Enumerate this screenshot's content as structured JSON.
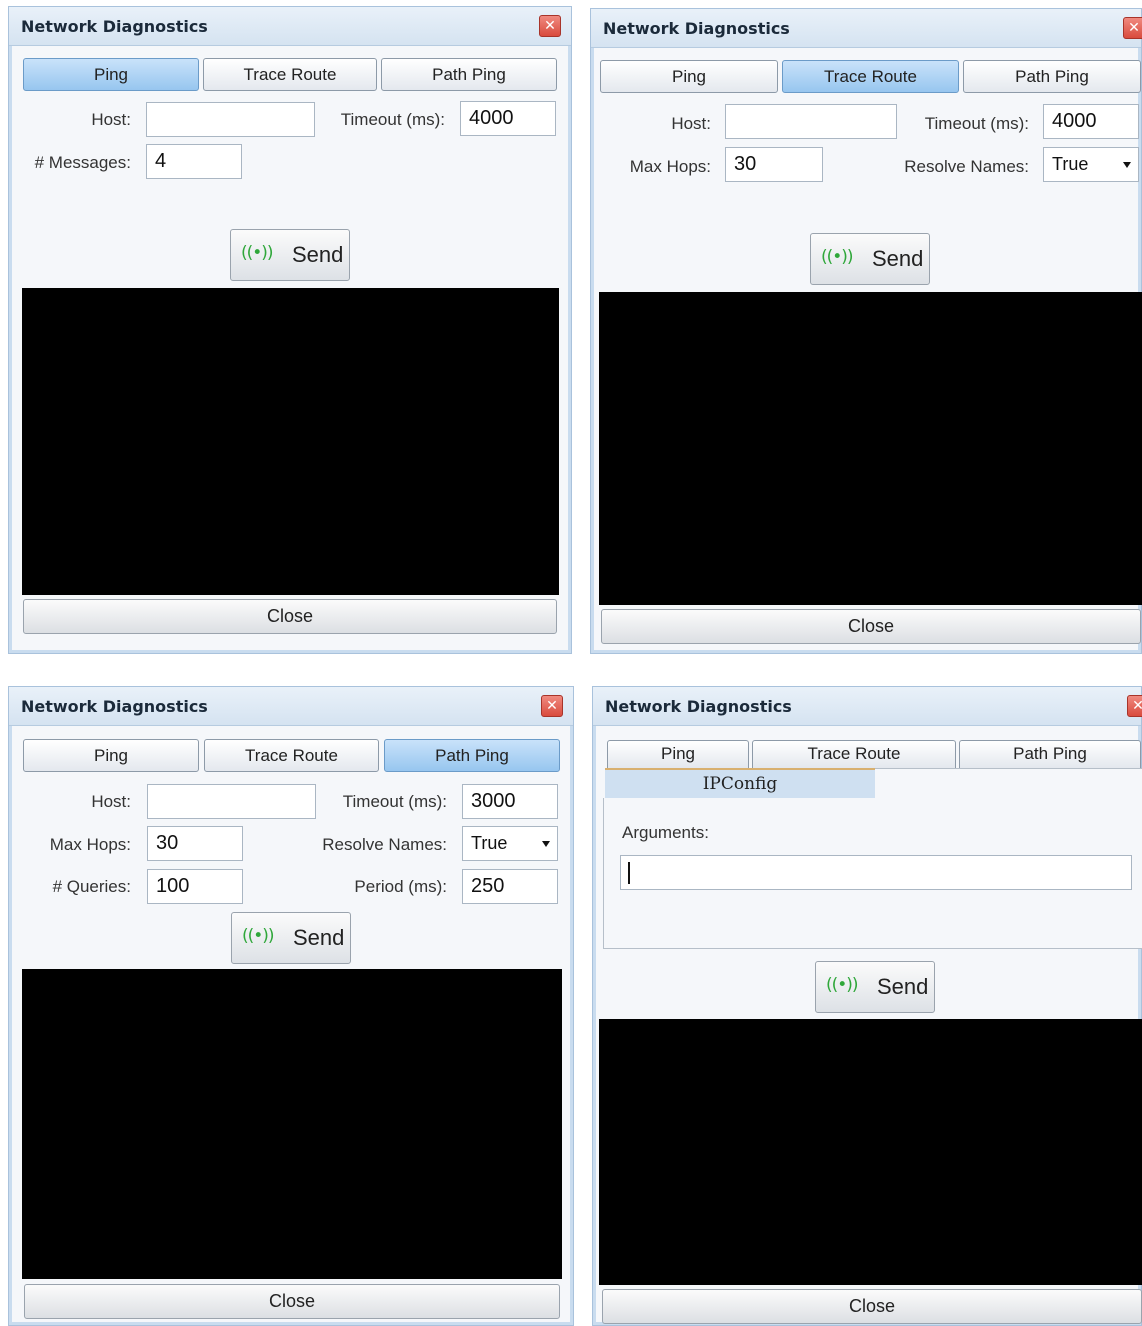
{
  "window_title": "Network Diagnostics",
  "close_glyph": "✕",
  "tabs": {
    "ping": "Ping",
    "trace_route": "Trace Route",
    "path_ping": "Path Ping",
    "ipconfig": "IPConfig"
  },
  "send_label": "Send",
  "send_icon": "((•))",
  "close_label": "Close",
  "ping_panel": {
    "active_tab": "Ping",
    "host_label": "Host:",
    "host_value": "",
    "timeout_label": "Timeout (ms):",
    "timeout_value": "4000",
    "messages_label": "# Messages:",
    "messages_value": "4"
  },
  "trace_panel": {
    "active_tab": "Trace Route",
    "host_label": "Host:",
    "host_value": "",
    "timeout_label": "Timeout (ms):",
    "timeout_value": "4000",
    "max_hops_label": "Max Hops:",
    "max_hops_value": "30",
    "resolve_label": "Resolve Names:",
    "resolve_value": "True"
  },
  "pathping_panel": {
    "active_tab": "Path Ping",
    "host_label": "Host:",
    "host_value": "",
    "timeout_label": "Timeout (ms):",
    "timeout_value": "3000",
    "max_hops_label": "Max Hops:",
    "max_hops_value": "30",
    "resolve_label": "Resolve Names:",
    "resolve_value": "True",
    "queries_label": "# Queries:",
    "queries_value": "100",
    "period_label": "Period (ms):",
    "period_value": "250"
  },
  "ipconfig_panel": {
    "active_tab": "IPConfig",
    "arguments_label": "Arguments:",
    "arguments_value": ""
  },
  "colors": {
    "active_tab": "#97c6ef",
    "console": "#000000",
    "send_icon": "#2fa73a",
    "close_x": "#d94b3d"
  }
}
